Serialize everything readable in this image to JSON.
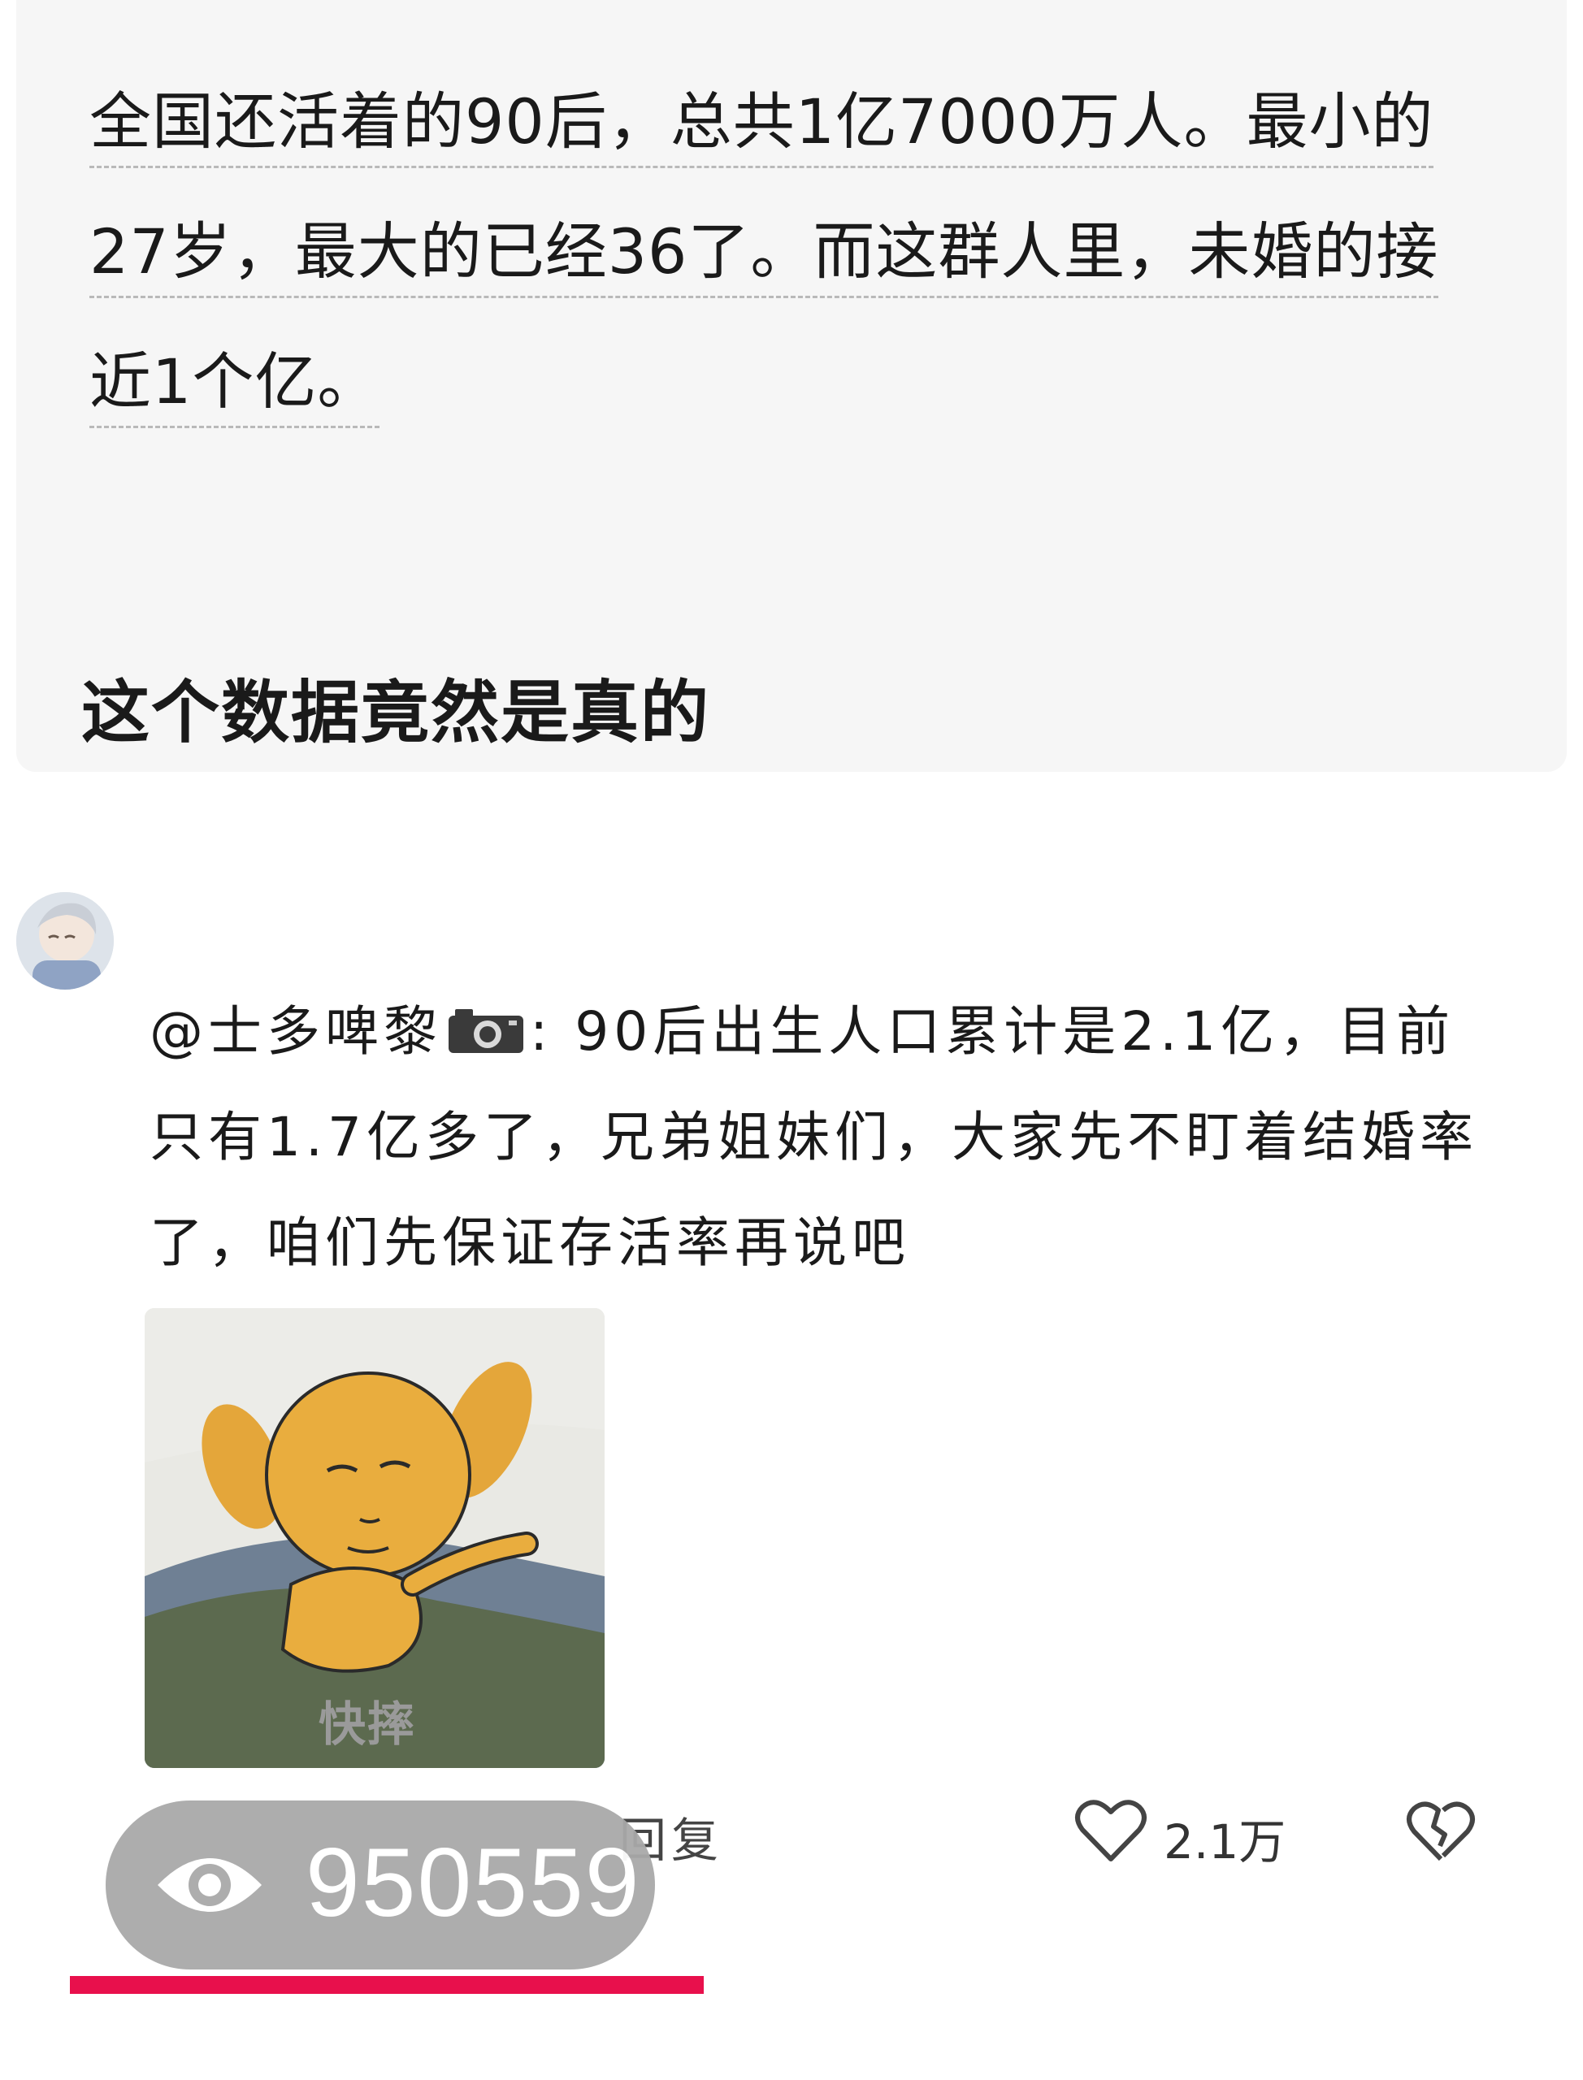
{
  "post": {
    "lines": [
      "全国还活着的90后，总共1亿7000万人。最小的",
      "27岁，最大的已经36了。而这群人里，未婚的接",
      "近1个亿。"
    ],
    "headline": "这个数据竟然是真的"
  },
  "comment": {
    "mention": "@士多啤黎",
    "text": ": 90后出生人口累计是2.1亿，目前只有1.7亿多了，兄弟姐妹们，大家先不盯着结婚率了，咱们先保证存活率再说吧",
    "sticker_caption": "快摔",
    "reply_label": "回复",
    "like_count": "2.1万"
  },
  "overlay": {
    "views": "950559",
    "underline_color": "#e8104c"
  },
  "icons": [
    "camera-icon",
    "heart-icon",
    "broken-heart-icon",
    "eye-icon"
  ]
}
